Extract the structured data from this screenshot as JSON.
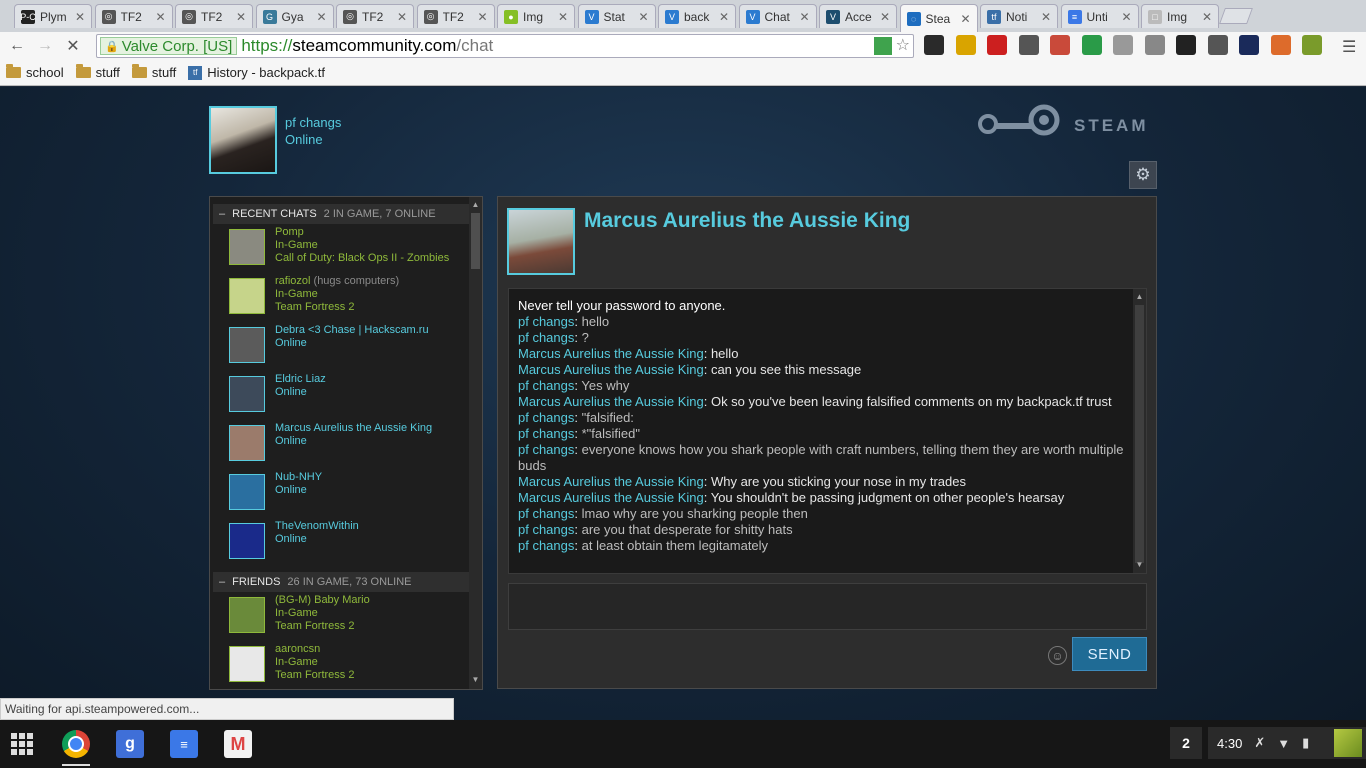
{
  "tabs": [
    {
      "title": "Plym",
      "fav": "P-C",
      "color": "#222"
    },
    {
      "title": "TF2",
      "fav": "◎",
      "color": "#555"
    },
    {
      "title": "TF2",
      "fav": "◎",
      "color": "#555"
    },
    {
      "title": "Gya",
      "fav": "G",
      "color": "#3a7a9a"
    },
    {
      "title": "TF2",
      "fav": "◎",
      "color": "#555"
    },
    {
      "title": "TF2",
      "fav": "◎",
      "color": "#555"
    },
    {
      "title": "Img",
      "fav": "●",
      "color": "#85bf25"
    },
    {
      "title": "Stat",
      "fav": "V",
      "color": "#2b7bd0"
    },
    {
      "title": "back",
      "fav": "V",
      "color": "#2b7bd0"
    },
    {
      "title": "Chat",
      "fav": "V",
      "color": "#2b7bd0"
    },
    {
      "title": "Acce",
      "fav": "V",
      "color": "#1d4d6e"
    },
    {
      "title": "Stea",
      "fav": "◌",
      "color": "#1e6dbf",
      "active": true
    },
    {
      "title": "Noti",
      "fav": "tf",
      "color": "#3a6fa8"
    },
    {
      "title": "Unti",
      "fav": "≡",
      "color": "#3b78e7"
    },
    {
      "title": "Img",
      "fav": "□",
      "color": "#bbb"
    }
  ],
  "omnibox": {
    "ev_label": "Valve Corp. [US]",
    "scheme": "https://",
    "host": "steamcommunity.com",
    "path": "/chat"
  },
  "bookmarks": [
    {
      "label": "school",
      "type": "folder"
    },
    {
      "label": "stuff",
      "type": "folder"
    },
    {
      "label": "stuff",
      "type": "folder"
    },
    {
      "label": "History - backpack.tf",
      "type": "link"
    }
  ],
  "profile": {
    "name": "pf changs",
    "status": "Online"
  },
  "steam_logo_text": "STEAM",
  "recent_chats": {
    "title": "RECENT CHATS",
    "count": "2 IN GAME, 7 ONLINE",
    "items": [
      {
        "name": "Pomp",
        "nick": "",
        "state": "In-Game",
        "game": "Call of Duty: Black Ops II - Zombies",
        "kind": "ingame",
        "color": "#8a8a80"
      },
      {
        "name": "rafiozol",
        "nick": "(hugs computers)",
        "state": "In-Game",
        "game": "Team Fortress 2",
        "kind": "ingame",
        "color": "#c6d48a"
      },
      {
        "name": "Debra <3 Chase | Hackscam.ru",
        "nick": "",
        "state": "Online",
        "game": "",
        "kind": "online",
        "color": "#5b5b5b"
      },
      {
        "name": "Eldric Liaz",
        "nick": "",
        "state": "Online",
        "game": "",
        "kind": "online",
        "color": "#3d4a5a"
      },
      {
        "name": "Marcus Aurelius the Aussie King",
        "nick": "",
        "state": "Online",
        "game": "",
        "kind": "online",
        "color": "#9b7b6b"
      },
      {
        "name": "Nub-NHY",
        "nick": "",
        "state": "Online",
        "game": "",
        "kind": "online",
        "color": "#2a6fa0"
      },
      {
        "name": "TheVenomWithin",
        "nick": "",
        "state": "Online",
        "game": "",
        "kind": "online",
        "color": "#1a2a8a"
      }
    ]
  },
  "friends": {
    "title": "FRIENDS",
    "count": "26 IN GAME, 73 ONLINE",
    "items": [
      {
        "name": "(BG-M) Baby Mario",
        "state": "In-Game",
        "game": "Team Fortress 2",
        "kind": "ingame",
        "color": "#6a8a3a"
      },
      {
        "name": "aaroncsn",
        "state": "In-Game",
        "game": "Team Fortress 2",
        "kind": "ingame",
        "color": "#e8e8e8"
      }
    ]
  },
  "chat": {
    "title": "Marcus Aurelius the Aussie King",
    "system": "Never tell your password to anyone.",
    "messages": [
      {
        "who": "pf changs",
        "text": "hello",
        "mine": true
      },
      {
        "who": "pf changs",
        "text": "?",
        "mine": true
      },
      {
        "who": "Marcus Aurelius the Aussie King",
        "text": "hello",
        "mine": false
      },
      {
        "who": "Marcus Aurelius the Aussie King",
        "text": "can you see this message",
        "mine": false
      },
      {
        "who": "pf changs",
        "text": "Yes why",
        "mine": true
      },
      {
        "who": "Marcus Aurelius the Aussie King",
        "text": "Ok so you've been leaving falsified comments on my backpack.tf trust",
        "mine": false
      },
      {
        "who": "pf changs",
        "text": "\"falsified:",
        "mine": true
      },
      {
        "who": "pf changs",
        "text": "*\"falsified\"",
        "mine": true
      },
      {
        "who": "pf changs",
        "text": "everyone knows how you shark people with craft numbers, telling them they are worth multiple buds",
        "mine": true
      },
      {
        "who": "Marcus Aurelius the Aussie King",
        "text": "Why are you sticking your nose in my trades",
        "mine": false
      },
      {
        "who": "Marcus Aurelius the Aussie King",
        "text": "You shouldn't be passing judgment on other people's hearsay",
        "mine": false
      },
      {
        "who": "pf changs",
        "text": "lmao why are you sharking people then",
        "mine": true
      },
      {
        "who": "pf changs",
        "text": "are you that desperate for shitty hats",
        "mine": true
      },
      {
        "who": "pf changs",
        "text": "at least obtain them legitamately",
        "mine": true
      }
    ],
    "send_label": "SEND"
  },
  "status_text": "Waiting for api.steampowered.com...",
  "shelf": {
    "badge": "2",
    "time": "4:30"
  }
}
